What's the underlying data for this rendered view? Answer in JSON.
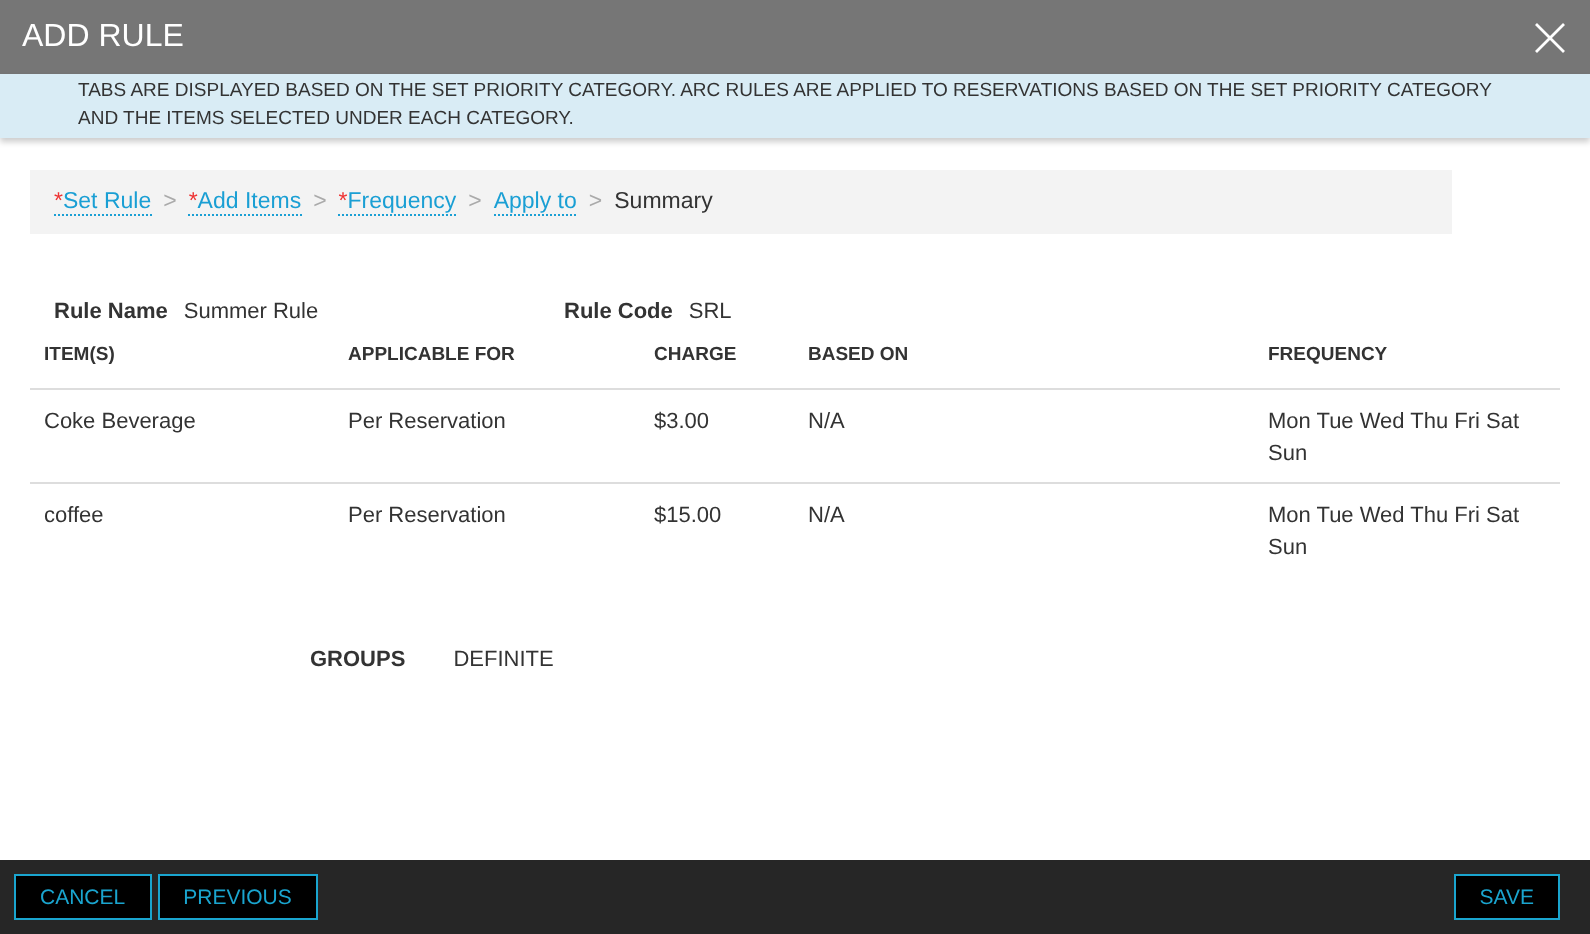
{
  "window": {
    "title": "ADD RULE"
  },
  "banner": "TABS ARE DISPLAYED BASED ON THE SET PRIORITY CATEGORY. ARC RULES ARE APPLIED TO RESERVATIONS BASED ON THE SET PRIORITY CATEGORY AND THE ITEMS SELECTED UNDER EACH CATEGORY.",
  "breadcrumb": [
    {
      "mark": "*",
      "label": "Set Rule",
      "kind": "link",
      "separator": ">"
    },
    {
      "mark": "*",
      "label": "Add Items",
      "kind": "link",
      "separator": ">"
    },
    {
      "mark": "*",
      "label": "Frequency",
      "kind": "link",
      "separator": ">"
    },
    {
      "label": "Apply to",
      "kind": "link",
      "separator": ">"
    },
    {
      "label": "Summary",
      "kind": "current"
    }
  ],
  "fields": [
    {
      "label": "Rule Name",
      "value": "Summer Rule"
    },
    {
      "label": "Rule Code",
      "value": "SRL"
    }
  ],
  "table": {
    "columns": [
      "ITEM(S)",
      "APPLICABLE FOR",
      "CHARGE",
      "BASED ON",
      "FREQUENCY"
    ],
    "rows": [
      [
        "Coke Beverage",
        "Per Reservation",
        "$3.00",
        "N/A",
        "Mon Tue Wed Thu Fri Sat Sun"
      ],
      [
        "coffee",
        "Per Reservation",
        "$15.00",
        "N/A",
        "Mon Tue Wed Thu Fri Sat Sun"
      ]
    ]
  },
  "apply_to": {
    "label": "GROUPS",
    "value": "DEFINITE"
  },
  "buttons_left": [
    "CANCEL",
    "PREVIOUS"
  ],
  "buttons_right": [
    "SAVE"
  ]
}
